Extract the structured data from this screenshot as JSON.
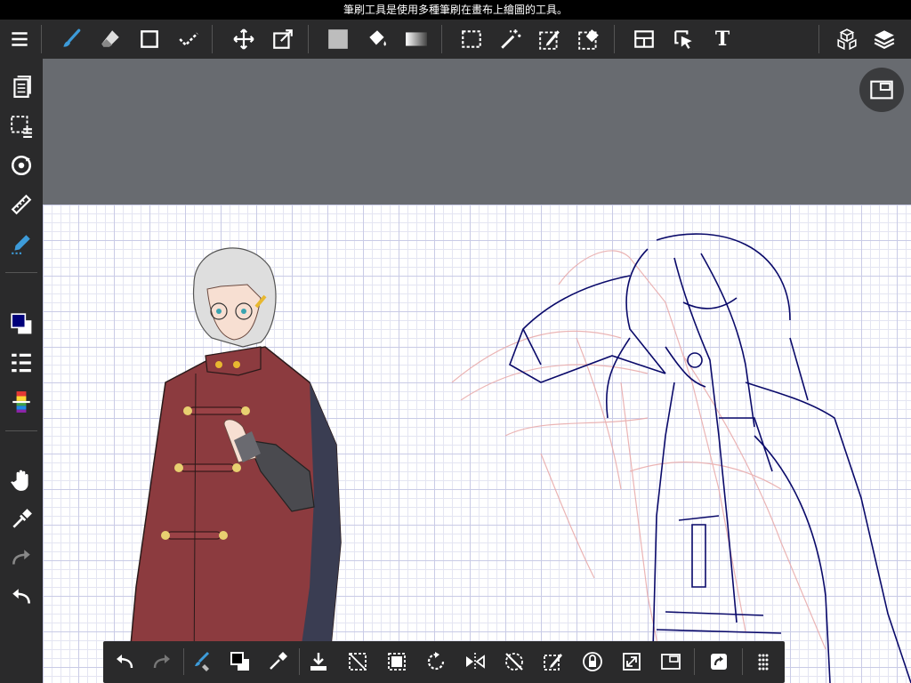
{
  "tooltip": {
    "text": "筆刷工具是使用多種筆刷在畫布上繪圖的工具。"
  },
  "colors": {
    "accent": "#3d9bd9",
    "toolbar_bg": "#2a2a2b",
    "workspace_bg": "#686b70",
    "primary_color": "#00007a",
    "secondary_color": "#ffffff"
  },
  "top_toolbar": {
    "items": [
      "menu-icon",
      "brush-icon",
      "eraser-icon",
      "shape-icon",
      "smudge-icon",
      "move-icon",
      "transform-icon",
      "fill-color-icon",
      "bucket-icon",
      "gradient-icon",
      "select-rect-icon",
      "magic-wand-icon",
      "select-pen-icon",
      "select-eraser-icon",
      "frame-divider-icon",
      "operation-icon",
      "text-icon",
      "3d-material-icon",
      "layers-icon"
    ],
    "text_tool_label": "T",
    "active": "brush-icon"
  },
  "left_toolbar": {
    "items": [
      "page-icon",
      "selection-layer-icon",
      "rotate-canvas-icon",
      "ruler-icon",
      "snap-pen-icon",
      "color-swatch-icon",
      "brush-list-icon",
      "color-palette-icon",
      "hand-icon",
      "eyedropper-icon",
      "redo-icon",
      "undo-icon"
    ]
  },
  "bottom_toolbar": {
    "items": [
      "undo-icon",
      "redo-icon",
      "brush-eraser-toggle-icon",
      "color-swap-icon",
      "eyedropper-icon",
      "import-icon",
      "clear-icon",
      "select-all-icon",
      "rotate-icon",
      "flip-icon",
      "deselect-icon",
      "selection-pen-icon",
      "lock-alpha-icon",
      "fullscreen-icon",
      "reference-window-icon",
      "share-icon",
      "more-icon"
    ]
  }
}
